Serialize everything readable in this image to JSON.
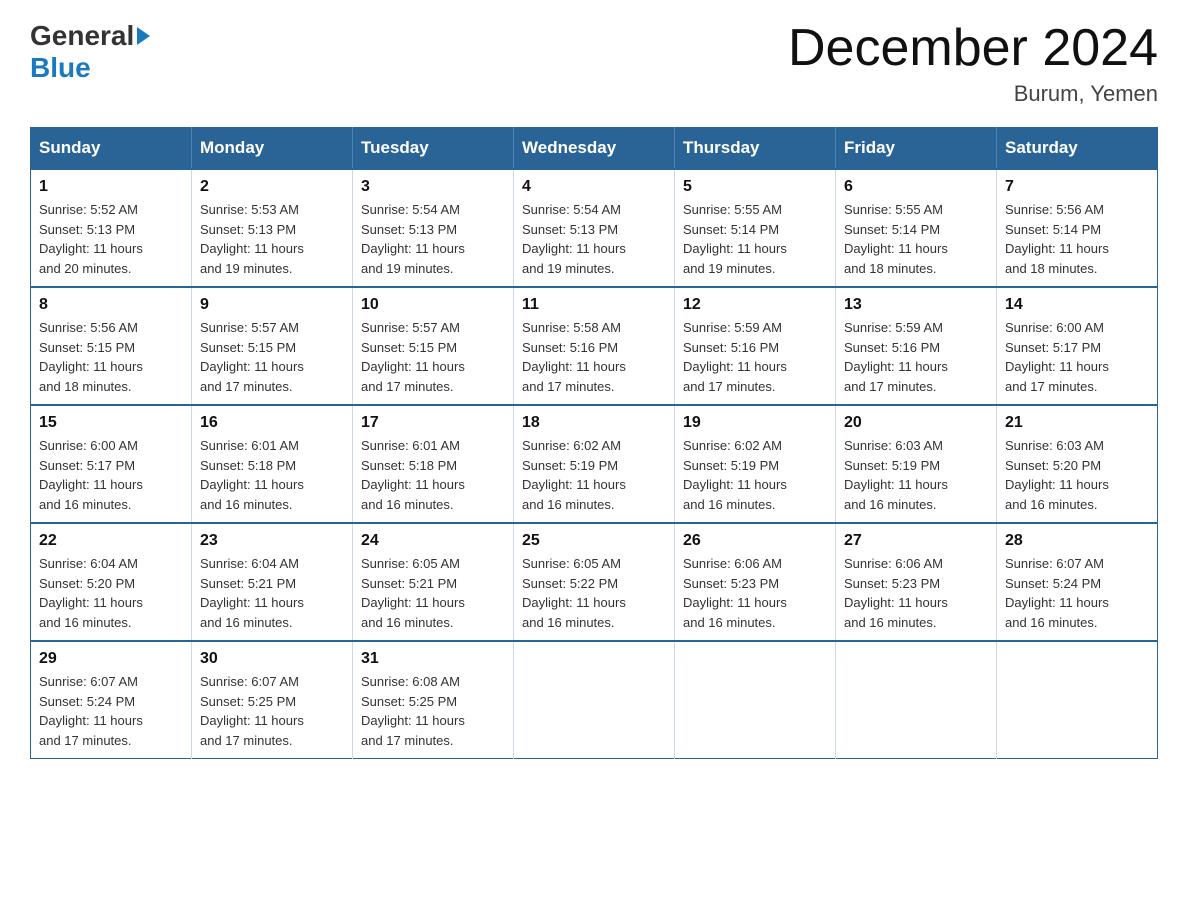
{
  "logo": {
    "general": "General",
    "blue": "Blue"
  },
  "title": "December 2024",
  "subtitle": "Burum, Yemen",
  "days_of_week": [
    "Sunday",
    "Monday",
    "Tuesday",
    "Wednesday",
    "Thursday",
    "Friday",
    "Saturday"
  ],
  "weeks": [
    [
      {
        "day": "1",
        "sunrise": "5:52 AM",
        "sunset": "5:13 PM",
        "daylight": "11 hours and 20 minutes."
      },
      {
        "day": "2",
        "sunrise": "5:53 AM",
        "sunset": "5:13 PM",
        "daylight": "11 hours and 19 minutes."
      },
      {
        "day": "3",
        "sunrise": "5:54 AM",
        "sunset": "5:13 PM",
        "daylight": "11 hours and 19 minutes."
      },
      {
        "day": "4",
        "sunrise": "5:54 AM",
        "sunset": "5:13 PM",
        "daylight": "11 hours and 19 minutes."
      },
      {
        "day": "5",
        "sunrise": "5:55 AM",
        "sunset": "5:14 PM",
        "daylight": "11 hours and 19 minutes."
      },
      {
        "day": "6",
        "sunrise": "5:55 AM",
        "sunset": "5:14 PM",
        "daylight": "11 hours and 18 minutes."
      },
      {
        "day": "7",
        "sunrise": "5:56 AM",
        "sunset": "5:14 PM",
        "daylight": "11 hours and 18 minutes."
      }
    ],
    [
      {
        "day": "8",
        "sunrise": "5:56 AM",
        "sunset": "5:15 PM",
        "daylight": "11 hours and 18 minutes."
      },
      {
        "day": "9",
        "sunrise": "5:57 AM",
        "sunset": "5:15 PM",
        "daylight": "11 hours and 17 minutes."
      },
      {
        "day": "10",
        "sunrise": "5:57 AM",
        "sunset": "5:15 PM",
        "daylight": "11 hours and 17 minutes."
      },
      {
        "day": "11",
        "sunrise": "5:58 AM",
        "sunset": "5:16 PM",
        "daylight": "11 hours and 17 minutes."
      },
      {
        "day": "12",
        "sunrise": "5:59 AM",
        "sunset": "5:16 PM",
        "daylight": "11 hours and 17 minutes."
      },
      {
        "day": "13",
        "sunrise": "5:59 AM",
        "sunset": "5:16 PM",
        "daylight": "11 hours and 17 minutes."
      },
      {
        "day": "14",
        "sunrise": "6:00 AM",
        "sunset": "5:17 PM",
        "daylight": "11 hours and 17 minutes."
      }
    ],
    [
      {
        "day": "15",
        "sunrise": "6:00 AM",
        "sunset": "5:17 PM",
        "daylight": "11 hours and 16 minutes."
      },
      {
        "day": "16",
        "sunrise": "6:01 AM",
        "sunset": "5:18 PM",
        "daylight": "11 hours and 16 minutes."
      },
      {
        "day": "17",
        "sunrise": "6:01 AM",
        "sunset": "5:18 PM",
        "daylight": "11 hours and 16 minutes."
      },
      {
        "day": "18",
        "sunrise": "6:02 AM",
        "sunset": "5:19 PM",
        "daylight": "11 hours and 16 minutes."
      },
      {
        "day": "19",
        "sunrise": "6:02 AM",
        "sunset": "5:19 PM",
        "daylight": "11 hours and 16 minutes."
      },
      {
        "day": "20",
        "sunrise": "6:03 AM",
        "sunset": "5:19 PM",
        "daylight": "11 hours and 16 minutes."
      },
      {
        "day": "21",
        "sunrise": "6:03 AM",
        "sunset": "5:20 PM",
        "daylight": "11 hours and 16 minutes."
      }
    ],
    [
      {
        "day": "22",
        "sunrise": "6:04 AM",
        "sunset": "5:20 PM",
        "daylight": "11 hours and 16 minutes."
      },
      {
        "day": "23",
        "sunrise": "6:04 AM",
        "sunset": "5:21 PM",
        "daylight": "11 hours and 16 minutes."
      },
      {
        "day": "24",
        "sunrise": "6:05 AM",
        "sunset": "5:21 PM",
        "daylight": "11 hours and 16 minutes."
      },
      {
        "day": "25",
        "sunrise": "6:05 AM",
        "sunset": "5:22 PM",
        "daylight": "11 hours and 16 minutes."
      },
      {
        "day": "26",
        "sunrise": "6:06 AM",
        "sunset": "5:23 PM",
        "daylight": "11 hours and 16 minutes."
      },
      {
        "day": "27",
        "sunrise": "6:06 AM",
        "sunset": "5:23 PM",
        "daylight": "11 hours and 16 minutes."
      },
      {
        "day": "28",
        "sunrise": "6:07 AM",
        "sunset": "5:24 PM",
        "daylight": "11 hours and 16 minutes."
      }
    ],
    [
      {
        "day": "29",
        "sunrise": "6:07 AM",
        "sunset": "5:24 PM",
        "daylight": "11 hours and 17 minutes."
      },
      {
        "day": "30",
        "sunrise": "6:07 AM",
        "sunset": "5:25 PM",
        "daylight": "11 hours and 17 minutes."
      },
      {
        "day": "31",
        "sunrise": "6:08 AM",
        "sunset": "5:25 PM",
        "daylight": "11 hours and 17 minutes."
      },
      null,
      null,
      null,
      null
    ]
  ],
  "labels": {
    "sunrise": "Sunrise:",
    "sunset": "Sunset:",
    "daylight": "Daylight:"
  }
}
